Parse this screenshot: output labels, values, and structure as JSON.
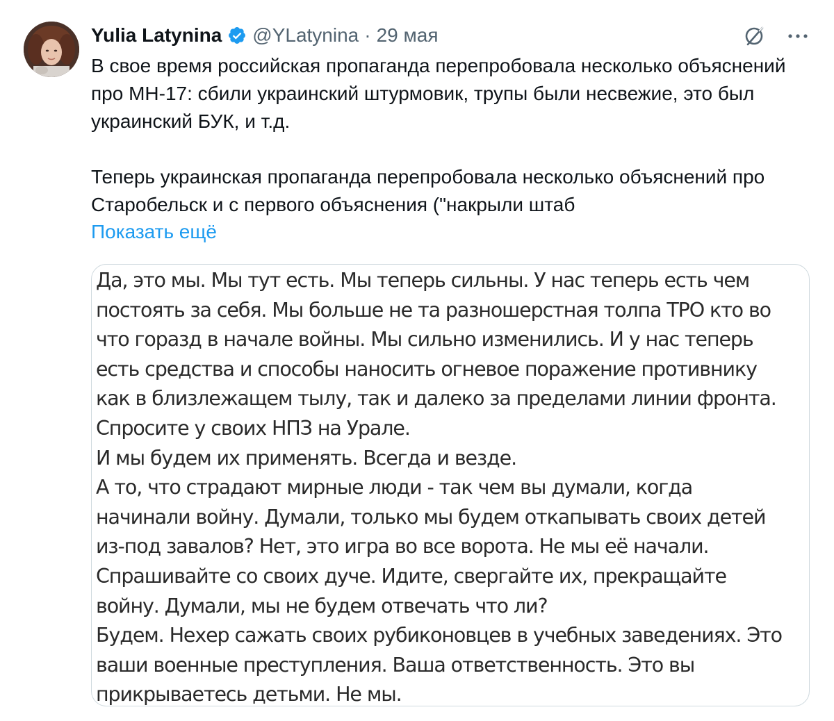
{
  "tweet": {
    "author_name": "Yulia Latynina",
    "handle": "@YLatynina",
    "separator": "·",
    "date": "29 мая",
    "text": [
      "В свое время российская пропаганда перепробовала несколько объяснений про МН-17: сбили украинский штурмовик, трупы были несвежие, это был украинский БУК, и т.д.",
      "Теперь украинская пропаганда перепробовала несколько объяснений про Старобельск и с первого объяснения (\"накрыли штаб"
    ],
    "show_more_label": "Показать ещё",
    "icons": {
      "verified": "verified-badge-icon",
      "grok": "grok-icon",
      "more": "more-icon"
    },
    "colors": {
      "accent": "#1d9bf0",
      "secondary_text": "#536471",
      "border": "#cfd9de"
    }
  },
  "media": {
    "paragraphs": [
      "Да, это мы. Мы тут есть. Мы теперь сильны. У нас теперь есть чем постоять за себя. Мы больше не та разношерстная толпа ТРО кто во что горазд в начале войны. Мы сильно изменились. И у нас теперь есть средства и способы наносить огневое поражение противнику как в близлежащем тылу, так и далеко за пределами линии фронта. Спросите у своих НПЗ на Урале.",
      "И мы будем их применять. Всегда и везде.",
      "А то, что страдают мирные люди - так чем вы думали, когда начинали войну. Думали, только мы будем откапывать своих детей из-под завалов? Нет, это игра во все ворота. Не мы её начали. Спрашивайте со своих дуче. Идите, свергайте их, прекращайте войну. Думали, мы не будем отвечать что ли?",
      "Будем. Нехер сажать своих рубиконовцев в учебных заведениях. Это ваши военные преступления. Ваша ответственность. Это вы прикрываетесь детьми. Не мы."
    ]
  }
}
